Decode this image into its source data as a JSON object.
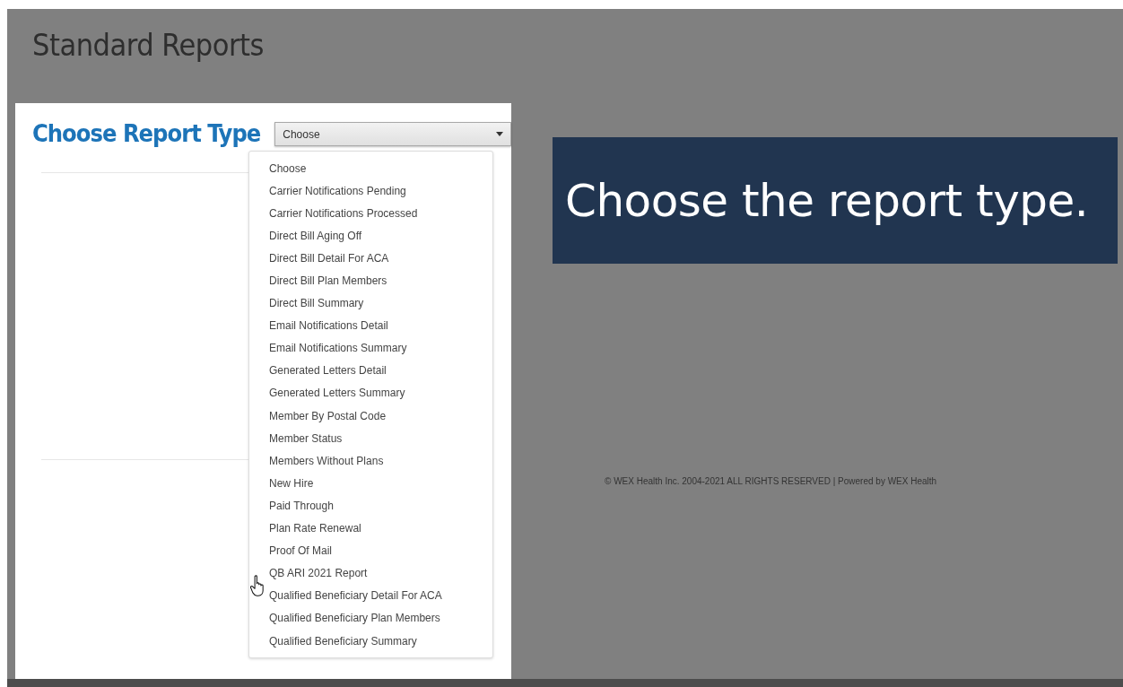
{
  "page": {
    "title": "Standard Reports"
  },
  "report_card": {
    "heading": "Choose Report Type",
    "select": {
      "value": "Choose",
      "expanded": true,
      "options": [
        {
          "label": "Choose"
        },
        {
          "label": "Carrier Notifications Pending"
        },
        {
          "label": "Carrier Notifications Processed"
        },
        {
          "label": "Direct Bill Aging Off"
        },
        {
          "label": "Direct Bill Detail For ACA"
        },
        {
          "label": "Direct Bill Plan Members"
        },
        {
          "label": "Direct Bill Summary"
        },
        {
          "label": "Email Notifications Detail"
        },
        {
          "label": "Email Notifications Summary"
        },
        {
          "label": "Generated Letters Detail"
        },
        {
          "label": "Generated Letters Summary"
        },
        {
          "label": "Member By Postal Code"
        },
        {
          "label": "Member Status"
        },
        {
          "label": "Members Without Plans"
        },
        {
          "label": "New Hire"
        },
        {
          "label": "Paid Through"
        },
        {
          "label": "Plan Rate Renewal"
        },
        {
          "label": "Proof Of Mail"
        },
        {
          "label": "QB ARI 2021 Report"
        },
        {
          "label": "Qualified Beneficiary Detail For ACA"
        },
        {
          "label": "Qualified Beneficiary Plan Members"
        },
        {
          "label": "Qualified Beneficiary Summary"
        }
      ]
    }
  },
  "caption": "Choose the report type.",
  "footer": "© WEX Health Inc. 2004-2021 ALL RIGHTS RESERVED | Powered by WEX Health"
}
